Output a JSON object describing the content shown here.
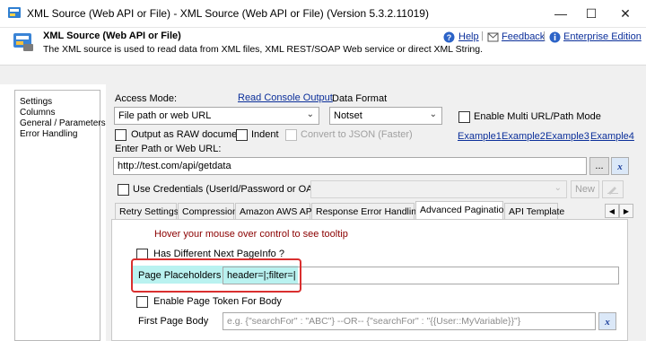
{
  "window": {
    "title": "XML Source (Web API or File) - XML Source (Web API or File) (Version 5.3.2.11019)",
    "minimize_glyph": "—",
    "maximize_glyph": "☐",
    "close_glyph": "✕"
  },
  "header": {
    "title": "XML Source (Web API or File)",
    "description": "The XML source is used to read data from XML files, XML REST/SOAP Web service or direct XML String.",
    "links": {
      "help": "Help",
      "feedback": "Feedback",
      "edition": "Enterprise Edition"
    },
    "separator": "|"
  },
  "sidebar": {
    "items": [
      {
        "label": "Settings"
      },
      {
        "label": "Columns"
      },
      {
        "label": "General / Parameters"
      },
      {
        "label": "Error Handling"
      }
    ]
  },
  "main": {
    "access_mode_label": "Access Mode:",
    "read_console_link": "Read Console Output",
    "access_mode_value": "File path or web URL",
    "data_format_label": "Data Format",
    "data_format_value": "Notset",
    "multi_url_label": "Enable Multi URL/Path Mode",
    "output_raw_label": "Output as RAW document",
    "indent_label": "Indent",
    "convert_json_label": "Convert to JSON (Faster)",
    "examples": [
      "Example1",
      "Example2",
      "Example3",
      "Example4"
    ],
    "path_label": "Enter Path or Web URL:",
    "path_value": "http://test.com/api/getdata",
    "browse_label": "...",
    "credentials_label": "Use Credentials (UserId/Password or OAuth)",
    "new_label": "New"
  },
  "tabs": [
    {
      "label": "Retry Settings"
    },
    {
      "label": "Compression"
    },
    {
      "label": "Amazon AWS API"
    },
    {
      "label": "Response Error Handling"
    },
    {
      "label": "Advanced Pagination"
    },
    {
      "label": "API Template"
    }
  ],
  "pagination": {
    "hint": "Hover your mouse over control to see tooltip",
    "different_next_label": "Has Different Next PageInfo ?",
    "placeholders_label": "Page Placeholders",
    "placeholders_value": "header=|;filter=|",
    "page_token_label": "Enable Page Token For Body",
    "first_body_label": "First Page Body",
    "first_body_placeholder": "e.g. {\"searchFor\" : \"ABC\"} --OR-- {\"searchFor\" : \"{{User::MyVariable}}\"}"
  },
  "colors": {
    "link": "#0b2f9a",
    "hint": "#8b0000",
    "highlight": "#b9f2f0",
    "annotation_box": "#d92f2f"
  }
}
